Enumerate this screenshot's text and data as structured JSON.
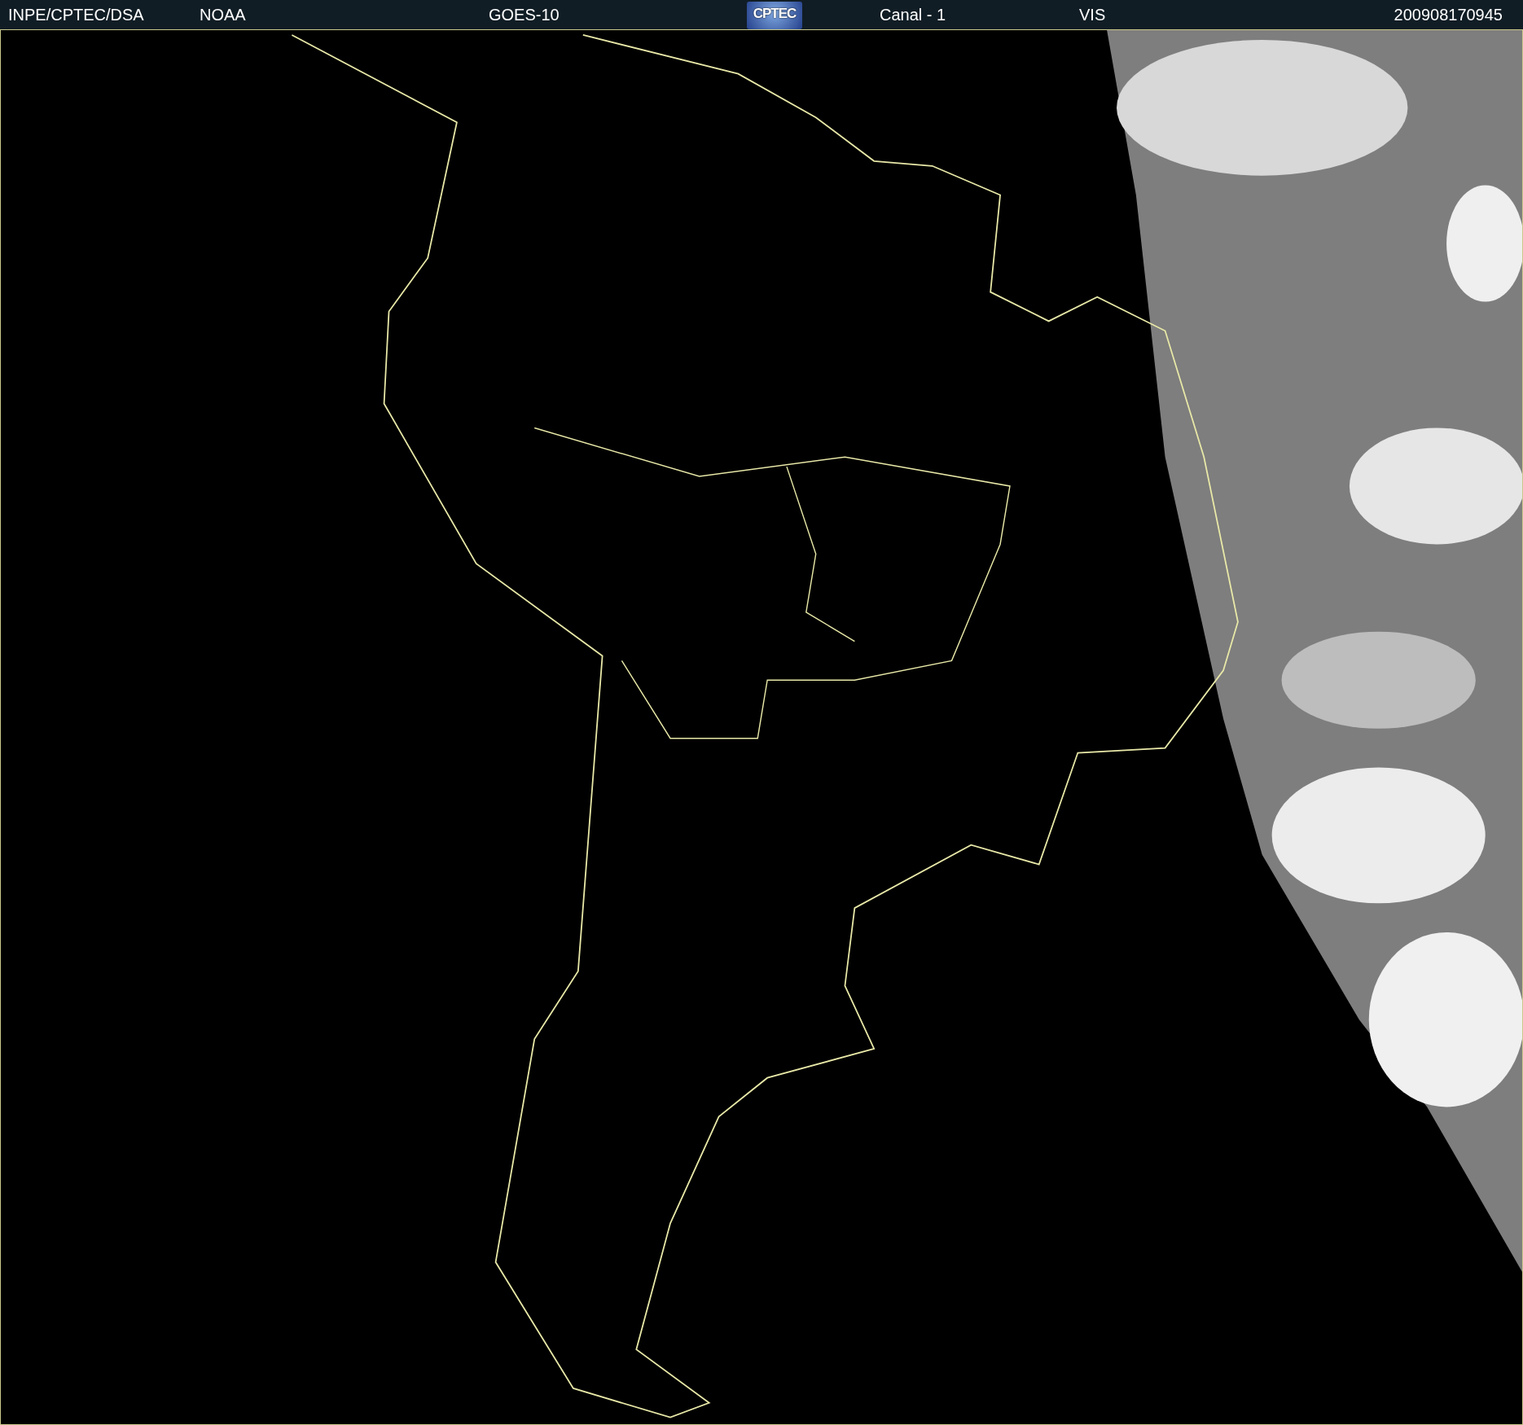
{
  "header": {
    "items": [
      {
        "kind": "text",
        "text": "INPE/CPTEC/DSA"
      },
      {
        "kind": "text",
        "text": "NOAA"
      },
      {
        "kind": "text",
        "text": "GOES-10"
      },
      {
        "kind": "logo",
        "text": "CPTEC"
      },
      {
        "kind": "text",
        "text": "Canal - 1"
      },
      {
        "kind": "text",
        "text": "VIS"
      },
      {
        "kind": "text",
        "text": "200908170945"
      }
    ]
  }
}
